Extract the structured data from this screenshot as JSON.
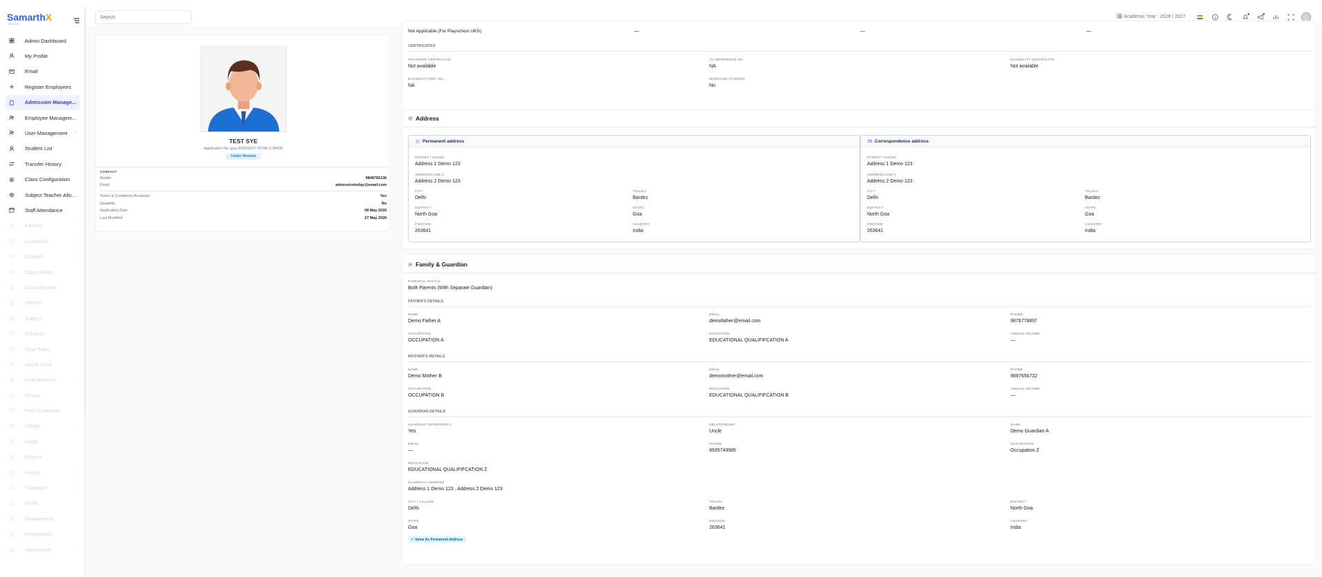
{
  "brand": {
    "name_main": "Samarth",
    "name_x": "X",
    "tagline": "SCHOOL"
  },
  "search": {
    "placeholder": "Search"
  },
  "topbar": {
    "academic_year": "Academic Year : 2026 / 2027"
  },
  "sidebar": {
    "items": [
      {
        "label": "Admin Dashboard",
        "icon": "grid-icon"
      },
      {
        "label": "My Profile",
        "icon": "user-icon"
      },
      {
        "label": "Email",
        "icon": "mail-icon"
      },
      {
        "label": "Register Employees",
        "icon": "plus-icon"
      },
      {
        "label": "Admission Manage...",
        "icon": "clipboard-icon"
      },
      {
        "label": "Employee Managem...",
        "icon": "users-icon"
      },
      {
        "label": "User Management",
        "icon": "users-icon"
      },
      {
        "label": "Student List",
        "icon": "user-icon"
      },
      {
        "label": "Transfer History",
        "icon": "transfer-icon"
      },
      {
        "label": "Class Configuration",
        "icon": "gear-icon"
      },
      {
        "label": "Subject Teacher Allo...",
        "icon": "gear-icon"
      },
      {
        "label": "Staff Attendance",
        "icon": "calendar-icon"
      },
      {
        "label": "Parents"
      },
      {
        "label": "Guardians"
      },
      {
        "label": "Classes"
      },
      {
        "label": "Class Room"
      },
      {
        "label": "Class Routine"
      },
      {
        "label": "Section"
      },
      {
        "label": "Subject"
      },
      {
        "label": "Syllabus"
      },
      {
        "label": "Time Table"
      },
      {
        "label": "Home Work"
      },
      {
        "label": "Examinations"
      },
      {
        "label": "Result"
      },
      {
        "label": "Fees Collection"
      },
      {
        "label": "Library"
      },
      {
        "label": "Staffs"
      },
      {
        "label": "Players"
      },
      {
        "label": "Hostel"
      },
      {
        "label": "Transport"
      },
      {
        "label": "Staffs"
      },
      {
        "label": "Departments"
      },
      {
        "label": "Designation"
      },
      {
        "label": "Attendance"
      }
    ]
  },
  "profile": {
    "name": "TEST SYE",
    "application_no": "Application No: goa-2026/2027-76786-2-39430",
    "status": "Under Review",
    "contact_label": "CONTACT",
    "mobile_label": "Mobile",
    "mobile": "9848782136",
    "email_label": "Email",
    "email": "admissiontoday@email.com",
    "terms_label": "Terms & Conditions Accepted",
    "terms": "Yes",
    "disability_label": "Disability",
    "disability": "No",
    "app_date_label": "Application Date",
    "app_date": "08 May 2026",
    "last_mod_label": "Last Modified",
    "last_mod": "27 May 2026"
  },
  "prev_row": {
    "c1": "Not Applicable (For Playschool UKG)",
    "c2": "—",
    "c3": "—",
    "c4": "—"
  },
  "certificates": {
    "heading": "CERTIFICATES",
    "tc_label": "TRANSFER CERTIFICATE",
    "tc": "Not available",
    "tcref_label": "TC REFERENCE NO.",
    "tcref": "NA",
    "elig_label": "ELIGIBILITY CERTIFICATE",
    "elig": "Not available",
    "eligref_label": "ELIGIBILITY REF. NO.",
    "eligref": "NA",
    "migrated_label": "MIGRATED STUDENT",
    "migrated": "No"
  },
  "address": {
    "title": "Address",
    "permanent": {
      "title": "Permanent address",
      "street_label": "STREET / HOUSE",
      "street": "Address 1 Demo 123",
      "line2_label": "ADDRESS LINE 2",
      "line2": "Address 2 Demo 123",
      "city_label": "CITY",
      "city": "Delhi",
      "taluka_label": "TALUKA",
      "taluka": "Bardez",
      "district_label": "DISTRICT",
      "district": "North Goa",
      "state_label": "STATE",
      "state": "Goa",
      "pincode_label": "PINCODE",
      "pincode": "263641",
      "country_label": "COUNTRY",
      "country": "India"
    },
    "correspondence": {
      "title": "Correspondence address",
      "street_label": "STREET / HOUSE",
      "street": "Address 1 Demo 123",
      "line2_label": "ADDRESS LINE 2",
      "line2": "Address 2 Demo 123",
      "city_label": "CITY",
      "city": "Delhi",
      "taluka_label": "TALUKA",
      "taluka": "Bardez",
      "district_label": "DISTRICT",
      "district": "North Goa",
      "state_label": "STATE",
      "state": "Goa",
      "pincode_label": "PINCODE",
      "pincode": "263641",
      "country_label": "COUNTRY",
      "country": "India"
    }
  },
  "family": {
    "title": "Family & Guardian",
    "parental_status_label": "PARENTAL STATUS",
    "parental_status": "Both Parents (With Separate Guardian)",
    "father": {
      "heading": "FATHER'S DETAILS",
      "name_label": "NAME",
      "name": "Demo Father A",
      "email_label": "EMAIL",
      "email": "demofather@email.com",
      "phone_label": "PHONE",
      "phone": "9876778897",
      "occupation_label": "OCCUPATION",
      "occupation": "OCCUPATION A",
      "education_label": "EDUCATION",
      "education": "EDUCATIONAL QUALIFIFCATION A",
      "income_label": "ANNUAL INCOME",
      "income": "—"
    },
    "mother": {
      "heading": "MOTHER'S DETAILS",
      "name_label": "NAME",
      "name": "Demo Mother B",
      "email_label": "EMAIL",
      "email": "demomother@email.com",
      "phone_label": "PHONE",
      "phone": "9897656732",
      "occupation_label": "OCCUPATION",
      "occupation": "OCCUPATION B",
      "education_label": "EDUCATION",
      "education": "EDUCATIONAL QUALIFIFCATION B",
      "income_label": "ANNUAL INCOME",
      "income": "—"
    },
    "guardian": {
      "heading": "GUARDIAN DETAILS",
      "different_label": "GUARDIAN DIFFERENTLY",
      "different": "Yes",
      "relationship_label": "RELATIONSHIP",
      "relationship": "Uncle",
      "name_label": "NAME",
      "name": "Demo Guardian A",
      "email_label": "EMAIL",
      "email": "—",
      "phone_label": "PHONE",
      "phone": "8935743985",
      "occupation_label": "OCCUPATION",
      "occupation": "Occupation Z",
      "education_label": "EDUCATION",
      "education": "EDUCATIONAL QUALIFIFCATION Z",
      "address_label": "GUARDIAN ADDRESS",
      "address": "Address 1 Demo 123 , Address 2 Demo 123",
      "city_label": "CITY / VILLAGE",
      "city": "Delhi",
      "taluka_label": "TALUKA",
      "taluka": "Bardez",
      "district_label": "DISTRICT",
      "district": "North Goa",
      "state_label": "STATE",
      "state": "Goa",
      "pincode_label": "PINCODE",
      "pincode": "263641",
      "country_label": "COUNTRY",
      "country": "India",
      "same_chip": "Same As Permanent Address"
    }
  }
}
